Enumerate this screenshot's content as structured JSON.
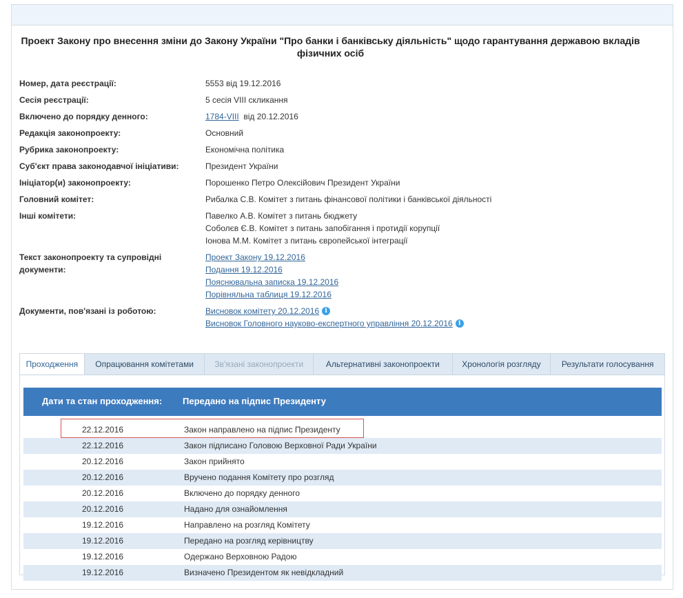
{
  "title": "Проект Закону про внесення зміни до Закону України \"Про банки і банківську діяльність\" щодо гарантування державою вкладів фізичних осіб",
  "fields": {
    "number": {
      "label": "Номер, дата реєстрації:",
      "value": "5553 від 19.12.2016"
    },
    "session": {
      "label": "Сесія реєстрації:",
      "value": "5 сесія VIII скликання"
    },
    "agenda": {
      "label": "Включено до порядку денного:",
      "link": "1784-VIII",
      "suffix": "від 20.12.2016"
    },
    "edition": {
      "label": "Редакція законопроекту:",
      "value": "Основний"
    },
    "rubric": {
      "label": "Рубрика законопроекту:",
      "value": "Економічна політика"
    },
    "subject": {
      "label": "Суб'єкт права законодавчої ініціативи:",
      "value": "Президент України"
    },
    "initiator": {
      "label": "Ініціатор(и) законопроекту:",
      "value": "Порошенко Петро Олексійович Президент України"
    },
    "main_committee": {
      "label": "Головний комітет:",
      "value": "Рибалка С.В. Комітет з питань фінансової політики і банківської діяльності"
    },
    "other_committees": {
      "label": "Інші комітети:",
      "items": [
        "Павелко А.В. Комітет з питань бюджету",
        "Соболєв Є.В. Комітет з питань запобігання і протидії корупції",
        "Іонова М.М. Комітет з питань європейської інтеграції"
      ]
    },
    "texts": {
      "label_line1": "Текст законопроекту та супровідні",
      "label_line2": "документи:",
      "items": [
        "Проект Закону 19.12.2016",
        "Подання 19.12.2016",
        "Пояснювальна записка 19.12.2016",
        "Порівняльна таблиця 19.12.2016"
      ]
    },
    "related_docs": {
      "label": "Документи, пов'язані із роботою:",
      "items": [
        "Висновок комітету 20.12.2016",
        "Висновок Головного науково-експертного управління 20.12.2016"
      ]
    }
  },
  "tabs": [
    "Проходження",
    "Опрацювання комітетами",
    "Зв'язані законопроекти",
    "Альтернативні законопроекти",
    "Хронологія розгляду",
    "Результати голосування"
  ],
  "table": {
    "header_label": "Дати та стан проходження:",
    "header_status": "Передано на підпис Президенту",
    "rows": [
      {
        "date": "22.12.2016",
        "event": "Закон направлено на підпис Президенту"
      },
      {
        "date": "22.12.2016",
        "event": "Закон підписано Головою Верховної Ради України"
      },
      {
        "date": "20.12.2016",
        "event": "Закон прийнято"
      },
      {
        "date": "20.12.2016",
        "event": "Вручено подання Комітету про розгляд"
      },
      {
        "date": "20.12.2016",
        "event": "Включено до порядку денного"
      },
      {
        "date": "20.12.2016",
        "event": "Надано для ознайомлення"
      },
      {
        "date": "19.12.2016",
        "event": "Направлено на розгляд Комітету"
      },
      {
        "date": "19.12.2016",
        "event": "Передано на розгляд керівництву"
      },
      {
        "date": "19.12.2016",
        "event": "Одержано Верховною Радою"
      },
      {
        "date": "19.12.2016",
        "event": "Визначено Президентом як невідкладний"
      }
    ]
  },
  "icons": {
    "info": "info-icon"
  },
  "colors": {
    "header_bg": "#3d7bbf",
    "alt_row": "#dfeaf5",
    "link": "#336699",
    "highlight": "#d9534f"
  }
}
